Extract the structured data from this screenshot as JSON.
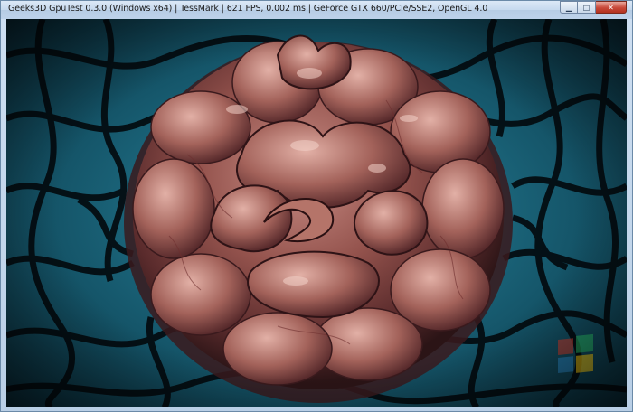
{
  "window": {
    "title": "Geeks3D GpuTest 0.3.0 (Windows x64) | TessMark | 621 FPS, 0.002 ms | GeForce GTX 660/PCIe/SSE2, OpenGL 4.0"
  },
  "controls": {
    "minimize_icon": "minimize-icon",
    "maximize_icon": "maximize-icon",
    "close_icon": "close-icon"
  },
  "scene": {
    "description_icon": "tessellated-blob-render",
    "colors": {
      "background_deep": "#06141c",
      "background_cell": "#1e6f86",
      "background_lines": "#02080c",
      "blob_base": "#8a4a45",
      "blob_light": "#d9a59a",
      "blob_shadow": "#3a1a1d"
    }
  }
}
